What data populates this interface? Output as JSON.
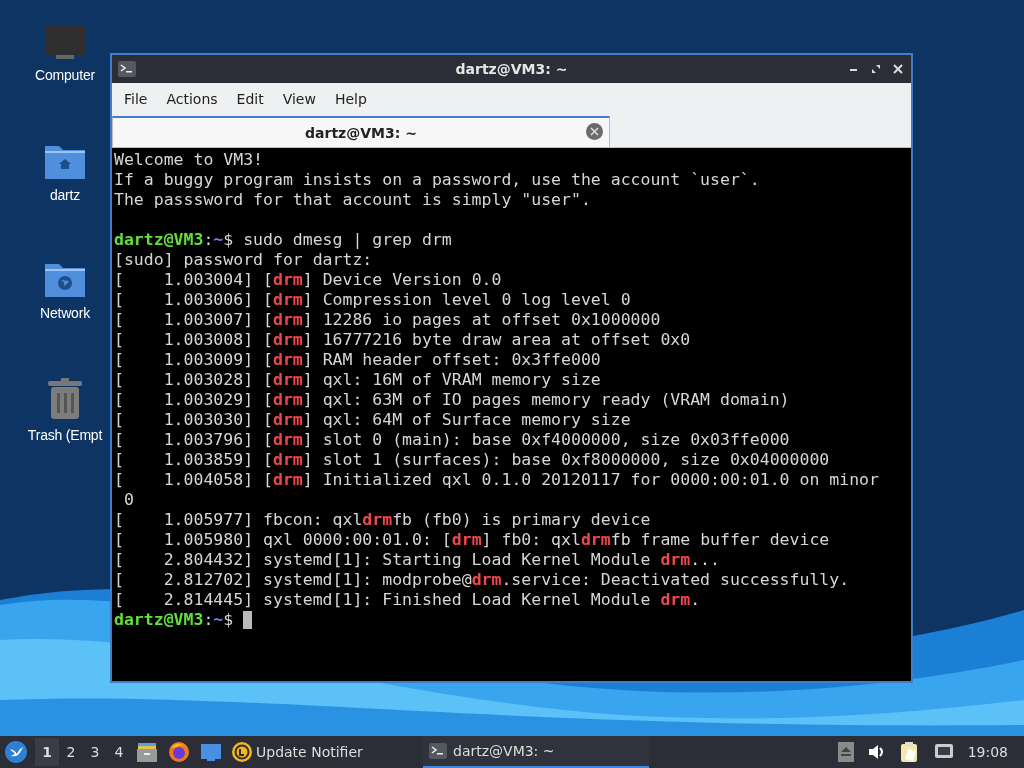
{
  "desktop_icons": [
    {
      "kind": "computer",
      "label": "Computer"
    },
    {
      "kind": "home",
      "label": "dartz"
    },
    {
      "kind": "network",
      "label": "Network"
    },
    {
      "kind": "trash",
      "label": "Trash (Empt"
    }
  ],
  "window": {
    "title": "dartz@VM3: ~",
    "menu": [
      "File",
      "Actions",
      "Edit",
      "View",
      "Help"
    ],
    "tabs": [
      {
        "label": "dartz@VM3: ~",
        "selected": true
      }
    ],
    "terminal": {
      "cursor": true,
      "lines": [
        {
          "kind": "output",
          "segments": [
            {
              "kind": "text",
              "text": "Welcome to VM3!"
            }
          ]
        },
        {
          "kind": "output",
          "segments": [
            {
              "kind": "text",
              "text": "If a buggy program insists on a password, use the account `user`."
            }
          ]
        },
        {
          "kind": "output",
          "segments": [
            {
              "kind": "text",
              "text": "The passsword for that account is simply \"user\"."
            }
          ]
        },
        {
          "kind": "blank"
        },
        {
          "kind": "output",
          "segments": [
            {
              "kind": "user",
              "text": "dartz@VM3"
            },
            {
              "kind": "text",
              "text": ":"
            },
            {
              "kind": "path",
              "text": "~"
            },
            {
              "kind": "text",
              "text": "$ sudo dmesg | grep drm"
            }
          ]
        },
        {
          "kind": "output",
          "segments": [
            {
              "kind": "text",
              "text": "[sudo] password for dartz:"
            }
          ]
        },
        {
          "kind": "output",
          "segments": [
            {
              "kind": "text",
              "text": "[    1.003004] ["
            },
            {
              "kind": "match",
              "text": "drm"
            },
            {
              "kind": "text",
              "text": "] Device Version 0.0"
            }
          ]
        },
        {
          "kind": "output",
          "segments": [
            {
              "kind": "text",
              "text": "[    1.003006] ["
            },
            {
              "kind": "match",
              "text": "drm"
            },
            {
              "kind": "text",
              "text": "] Compression level 0 log level 0"
            }
          ]
        },
        {
          "kind": "output",
          "segments": [
            {
              "kind": "text",
              "text": "[    1.003007] ["
            },
            {
              "kind": "match",
              "text": "drm"
            },
            {
              "kind": "text",
              "text": "] 12286 io pages at offset 0x1000000"
            }
          ]
        },
        {
          "kind": "output",
          "segments": [
            {
              "kind": "text",
              "text": "[    1.003008] ["
            },
            {
              "kind": "match",
              "text": "drm"
            },
            {
              "kind": "text",
              "text": "] 16777216 byte draw area at offset 0x0"
            }
          ]
        },
        {
          "kind": "output",
          "segments": [
            {
              "kind": "text",
              "text": "[    1.003009] ["
            },
            {
              "kind": "match",
              "text": "drm"
            },
            {
              "kind": "text",
              "text": "] RAM header offset: 0x3ffe000"
            }
          ]
        },
        {
          "kind": "output",
          "segments": [
            {
              "kind": "text",
              "text": "[    1.003028] ["
            },
            {
              "kind": "match",
              "text": "drm"
            },
            {
              "kind": "text",
              "text": "] qxl: 16M of VRAM memory size"
            }
          ]
        },
        {
          "kind": "output",
          "segments": [
            {
              "kind": "text",
              "text": "[    1.003029] ["
            },
            {
              "kind": "match",
              "text": "drm"
            },
            {
              "kind": "text",
              "text": "] qxl: 63M of IO pages memory ready (VRAM domain)"
            }
          ]
        },
        {
          "kind": "output",
          "segments": [
            {
              "kind": "text",
              "text": "[    1.003030] ["
            },
            {
              "kind": "match",
              "text": "drm"
            },
            {
              "kind": "text",
              "text": "] qxl: 64M of Surface memory size"
            }
          ]
        },
        {
          "kind": "output",
          "segments": [
            {
              "kind": "text",
              "text": "[    1.003796] ["
            },
            {
              "kind": "match",
              "text": "drm"
            },
            {
              "kind": "text",
              "text": "] slot 0 (main): base 0xf4000000, size 0x03ffe000"
            }
          ]
        },
        {
          "kind": "output",
          "segments": [
            {
              "kind": "text",
              "text": "[    1.003859] ["
            },
            {
              "kind": "match",
              "text": "drm"
            },
            {
              "kind": "text",
              "text": "] slot 1 (surfaces): base 0xf8000000, size 0x04000000"
            }
          ]
        },
        {
          "kind": "output",
          "segments": [
            {
              "kind": "text",
              "text": "[    1.004058] ["
            },
            {
              "kind": "match",
              "text": "drm"
            },
            {
              "kind": "text",
              "text": "] Initialized qxl 0.1.0 20120117 for 0000:00:01.0 on minor"
            }
          ]
        },
        {
          "kind": "output",
          "segments": [
            {
              "kind": "text",
              "text": " 0"
            }
          ]
        },
        {
          "kind": "output",
          "segments": [
            {
              "kind": "text",
              "text": "[    1.005977] fbcon: qxl"
            },
            {
              "kind": "match",
              "text": "drm"
            },
            {
              "kind": "text",
              "text": "fb (fb0) is primary device"
            }
          ]
        },
        {
          "kind": "output",
          "segments": [
            {
              "kind": "text",
              "text": "[    1.005980] qxl 0000:00:01.0: ["
            },
            {
              "kind": "match",
              "text": "drm"
            },
            {
              "kind": "text",
              "text": "] fb0: qxl"
            },
            {
              "kind": "match",
              "text": "drm"
            },
            {
              "kind": "text",
              "text": "fb frame buffer device"
            }
          ]
        },
        {
          "kind": "output",
          "segments": [
            {
              "kind": "text",
              "text": "[    2.804432] systemd[1]: Starting Load Kernel Module "
            },
            {
              "kind": "match",
              "text": "drm"
            },
            {
              "kind": "text",
              "text": "..."
            }
          ]
        },
        {
          "kind": "output",
          "segments": [
            {
              "kind": "text",
              "text": "[    2.812702] systemd[1]: modprobe@"
            },
            {
              "kind": "match",
              "text": "drm"
            },
            {
              "kind": "text",
              "text": ".service: Deactivated successfully."
            }
          ]
        },
        {
          "kind": "output",
          "segments": [
            {
              "kind": "text",
              "text": "[    2.814445] systemd[1]: Finished Load Kernel Module "
            },
            {
              "kind": "match",
              "text": "drm"
            },
            {
              "kind": "text",
              "text": "."
            }
          ]
        },
        {
          "kind": "output",
          "segments": [
            {
              "kind": "user",
              "text": "dartz@VM3"
            },
            {
              "kind": "text",
              "text": ":"
            },
            {
              "kind": "path",
              "text": "~"
            },
            {
              "kind": "text",
              "text": "$ "
            }
          ]
        }
      ]
    }
  },
  "taskbar": {
    "workspaces": [
      {
        "label": "1",
        "selected": true
      },
      {
        "label": "2",
        "selected": false
      },
      {
        "label": "3",
        "selected": false
      },
      {
        "label": "4",
        "selected": false
      }
    ],
    "update_notifier": {
      "label": "Update Notifier"
    },
    "tasks": [
      {
        "label": "dartz@VM3: ~",
        "selected": true
      }
    ],
    "clock": "19:08"
  }
}
